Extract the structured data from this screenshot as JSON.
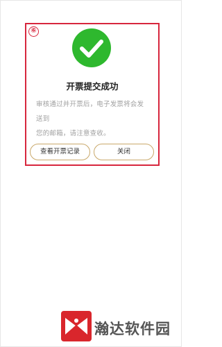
{
  "step_marker": "⑥",
  "dialog": {
    "title": "开票提交成功",
    "message_line1": "审核通过并开票后，电子发票将会发送到",
    "message_line2": "您的邮箱，请注意查收。",
    "buttons": {
      "view_records": "查看开票记录",
      "close": "关闭"
    }
  },
  "watermark": {
    "text": "瀚达软件园"
  },
  "colors": {
    "success": "#2eb82e",
    "highlight": "#d7263d",
    "button_border": "#c9a86a"
  },
  "icons": {
    "success": "check-circle-icon",
    "logo": "watermark-logo-icon"
  }
}
